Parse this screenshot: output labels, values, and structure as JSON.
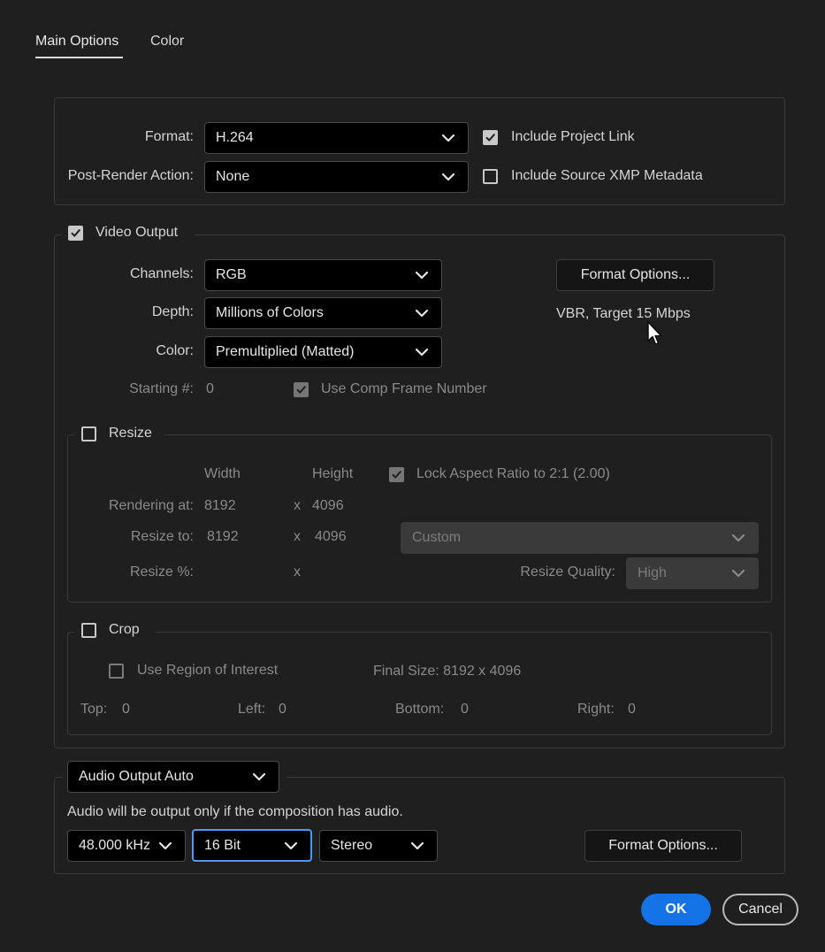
{
  "tabs": [
    {
      "label": "Main Options",
      "active": true
    },
    {
      "label": "Color",
      "active": false
    }
  ],
  "top": {
    "format_label": "Format:",
    "format_value": "H.264",
    "post_render_label": "Post-Render Action:",
    "post_render_value": "None",
    "include_project_link": {
      "label": "Include Project Link",
      "checked": true
    },
    "include_xmp": {
      "label": "Include Source XMP Metadata",
      "checked": false
    }
  },
  "video": {
    "title": "Video Output",
    "checked": true,
    "channels_label": "Channels:",
    "channels_value": "RGB",
    "depth_label": "Depth:",
    "depth_value": "Millions of Colors",
    "color_label": "Color:",
    "color_value": "Premultiplied (Matted)",
    "format_options_button": "Format Options...",
    "bitrate_info": "VBR, Target 15 Mbps",
    "starting_label": "Starting #:",
    "starting_value": "0",
    "use_comp_frame": {
      "label": "Use Comp Frame Number",
      "checked": true
    }
  },
  "resize": {
    "title": "Resize",
    "checked": false,
    "width_header": "Width",
    "height_header": "Height",
    "lock_aspect": {
      "label": "Lock Aspect Ratio to 2:1 (2.00)",
      "checked": true
    },
    "rendering_at_label": "Rendering at:",
    "rendering_w": "8192",
    "rendering_x": "x",
    "rendering_h": "4096",
    "resize_to_label": "Resize to:",
    "resize_w": "8192",
    "resize_x": "x",
    "resize_h": "4096",
    "preset_value": "Custom",
    "percent_label": "Resize %:",
    "percent_x": "x",
    "quality_label": "Resize Quality:",
    "quality_value": "High"
  },
  "crop": {
    "title": "Crop",
    "checked": false,
    "use_roi": {
      "label": "Use Region of Interest",
      "checked": false
    },
    "final_size": "Final Size: 8192 x 4096",
    "top_label": "Top:",
    "top_value": "0",
    "left_label": "Left:",
    "left_value": "0",
    "bottom_label": "Bottom:",
    "bottom_value": "0",
    "right_label": "Right:",
    "right_value": "0"
  },
  "audio": {
    "mode_value": "Audio Output Auto",
    "note": "Audio will be output only if the composition has audio.",
    "rate_value": "48.000 kHz",
    "bit_value": "16 Bit",
    "channels_value": "Stereo",
    "format_options_button": "Format Options..."
  },
  "footer": {
    "ok": "OK",
    "cancel": "Cancel"
  },
  "colors": {
    "background": "#1f1f1f",
    "accent": "#1473e6",
    "focus": "#4b9cf5"
  },
  "icons": [
    "chevron-down-icon",
    "checkmark-icon",
    "cursor-arrow-icon"
  ]
}
